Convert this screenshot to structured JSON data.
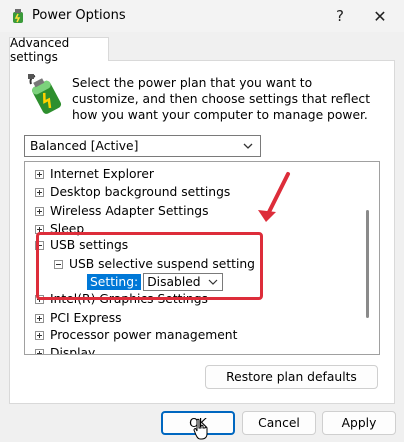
{
  "window": {
    "title": "Power Options",
    "help_label": "?",
    "close_label": "✕"
  },
  "tab": {
    "label": "Advanced settings"
  },
  "intro_text": "Select the power plan that you want to customize, and then choose settings that reflect how you want your computer to manage power.",
  "plan_select": {
    "value": "Balanced [Active]"
  },
  "tree": {
    "items": [
      {
        "label": "Internet Explorer",
        "expander": "plus"
      },
      {
        "label": "Desktop background settings",
        "expander": "plus"
      },
      {
        "label": "Wireless Adapter Settings",
        "expander": "plus"
      },
      {
        "label": "Sleep",
        "expander": "plus"
      },
      {
        "label": "USB settings",
        "expander": "minus"
      },
      {
        "label": "USB selective suspend setting",
        "expander": "minus"
      },
      {
        "label": "Intel(R) Graphics Settings",
        "expander": "plus"
      },
      {
        "label": "PCI Express",
        "expander": "plus"
      },
      {
        "label": "Processor power management",
        "expander": "plus"
      },
      {
        "label": "Display",
        "expander": "plus"
      }
    ],
    "setting_label": "Setting:",
    "setting_value": "Disabled"
  },
  "buttons": {
    "restore": "Restore plan defaults",
    "ok": "OK",
    "cancel": "Cancel",
    "apply": "Apply"
  },
  "colors": {
    "accent": "#0078d7",
    "annotation_red": "#dd2d3a"
  },
  "icons": [
    "power-options-icon",
    "battery-plug-icon",
    "chevron-down-icon",
    "mouse-cursor-icon"
  ]
}
